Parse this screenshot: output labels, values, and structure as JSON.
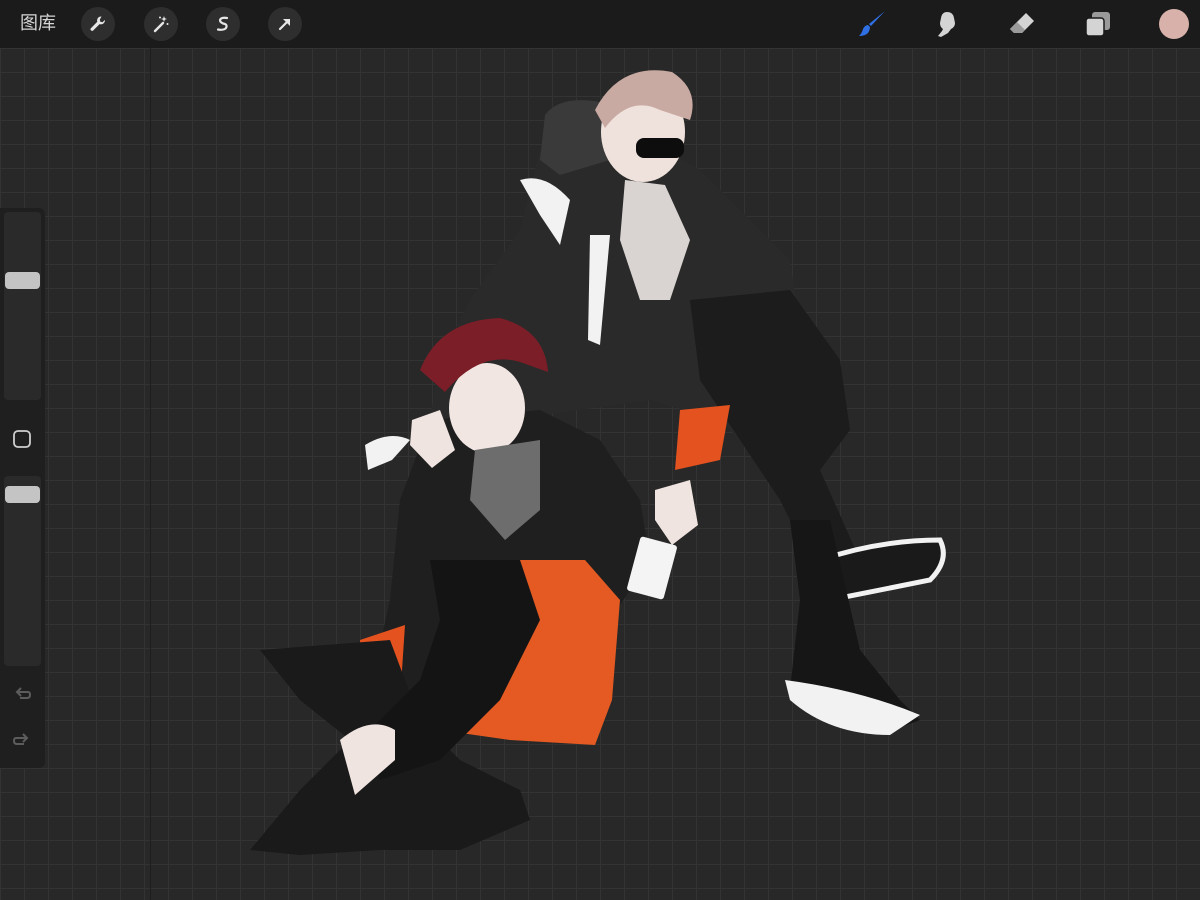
{
  "toolbar": {
    "gallery_label": "图库",
    "left_tools": [
      {
        "name": "actions",
        "icon": "wrench-icon"
      },
      {
        "name": "adjustments",
        "icon": "magic-wand-icon"
      },
      {
        "name": "selection",
        "icon": "selection-s-icon"
      },
      {
        "name": "transform",
        "icon": "arrow-cursor-icon"
      }
    ],
    "right_tools": [
      {
        "name": "brush",
        "icon": "brush-icon",
        "active": true
      },
      {
        "name": "smudge",
        "icon": "smudge-finger-icon",
        "active": false
      },
      {
        "name": "eraser",
        "icon": "eraser-icon",
        "active": false
      },
      {
        "name": "layers",
        "icon": "layers-icon",
        "active": false
      }
    ],
    "current_color": "#d8b2aa",
    "active_tool_color": "#2f6fe4",
    "inactive_tool_color": "#d4d4d4"
  },
  "sidebar": {
    "brush_size_level": 0.35,
    "opacity_level": 0.06,
    "modify_icon": "square-outline-icon",
    "undo_icon": "undo-arrow-icon",
    "redo_icon": "redo-arrow-icon"
  },
  "canvas": {
    "artwork": "illustration-two-characters-icon"
  }
}
